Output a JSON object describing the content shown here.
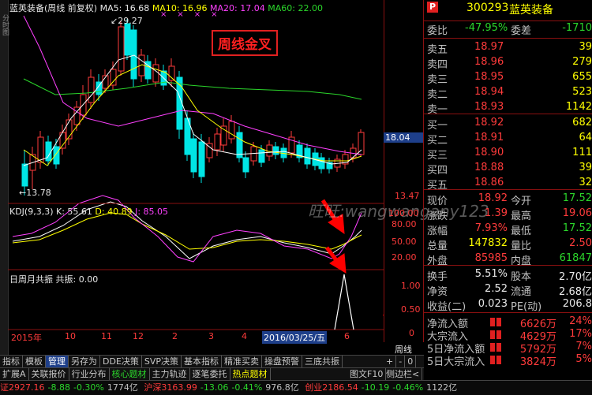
{
  "header": {
    "stock_name": "蓝英装备",
    "period": "周线 前复权",
    "ma5": "MA5: 16.68",
    "ma10": "MA10: 16.96",
    "ma20": "MA20: 17.04",
    "ma60": "MA60: 22.00"
  },
  "annotation": {
    "title": "周线金叉",
    "watermark": "旺旺:wangwangany123"
  },
  "price_axis": {
    "high_label": "29.27",
    "low_label": "13.78",
    "current": "18.04",
    "bottom": "13.47"
  },
  "kdj": {
    "title": "KDJ(9,3,3)",
    "k": "K: 55.61",
    "d": "D: 40.89",
    "j": "J: 85.05",
    "ticks": [
      "100.00",
      "80.00",
      "50.00",
      "20.00"
    ]
  },
  "resonance": {
    "title": "日周月共振",
    "value": "共振: 0.00",
    "ticks": [
      "1.00",
      "0.50",
      "0"
    ]
  },
  "timeline": {
    "labels": [
      "2015年",
      "10",
      "11",
      "12",
      "2",
      "3",
      "4",
      "5",
      "6"
    ],
    "highlight": "2016/03/25/五",
    "period_button": "周线"
  },
  "tabs": [
    "指标",
    "模板",
    "管理",
    "另存为",
    "DDE决策",
    "SVP决策",
    "基本指标",
    "精准买卖",
    "操盘预警",
    "三底共振"
  ],
  "tabs2": [
    "扩展A",
    "关联报价",
    "行业分布",
    "核心题材",
    "主力轨迹",
    "逐笔委托",
    "热点题材"
  ],
  "tabs2_right": [
    "图文F10",
    "侧边栏<"
  ],
  "controls": {
    "plus": "+",
    "minus": "-",
    "zero": "0",
    "pen": "笔"
  },
  "quote": {
    "code": "300293",
    "name": "蓝英装备",
    "wb_label": "委比",
    "wb_value": "-47.95%",
    "wc_label": "委差",
    "wc_value": "-1710",
    "asks": [
      {
        "label": "卖五",
        "price": "18.97",
        "vol": "39"
      },
      {
        "label": "卖四",
        "price": "18.96",
        "vol": "279"
      },
      {
        "label": "卖三",
        "price": "18.95",
        "vol": "655"
      },
      {
        "label": "卖二",
        "price": "18.94",
        "vol": "523"
      },
      {
        "label": "卖一",
        "price": "18.93",
        "vol": "1142"
      }
    ],
    "bids": [
      {
        "label": "买一",
        "price": "18.92",
        "vol": "682"
      },
      {
        "label": "买二",
        "price": "18.91",
        "vol": "64"
      },
      {
        "label": "买三",
        "price": "18.90",
        "vol": "111"
      },
      {
        "label": "买四",
        "price": "18.88",
        "vol": "39"
      },
      {
        "label": "买五",
        "price": "18.86",
        "vol": "32"
      }
    ],
    "stats": [
      {
        "l1": "现价",
        "v1": "18.92",
        "l2": "今开",
        "v2": "17.52",
        "c1": "red",
        "c2": "green"
      },
      {
        "l1": "涨跌",
        "v1": "1.39",
        "l2": "最高",
        "v2": "19.06",
        "c1": "red",
        "c2": "red"
      },
      {
        "l1": "涨幅",
        "v1": "7.93%",
        "l2": "最低",
        "v2": "17.52",
        "c1": "red",
        "c2": "green"
      },
      {
        "l1": "总量",
        "v1": "147832",
        "l2": "量比",
        "v2": "2.50",
        "c1": "yellow",
        "c2": "red"
      },
      {
        "l1": "外盘",
        "v1": "85985",
        "l2": "内盘",
        "v2": "61847",
        "c1": "red",
        "c2": "green"
      }
    ],
    "stats2": [
      {
        "l1": "换手",
        "v1": "5.51%",
        "l2": "股本",
        "v2": "2.70亿"
      },
      {
        "l1": "净资",
        "v1": "2.52",
        "l2": "流通",
        "v2": "2.68亿"
      },
      {
        "l1": "收益(二)",
        "v1": "0.023",
        "l2": "PE(动)",
        "v2": "206.8"
      }
    ],
    "flows": [
      {
        "label": "净流入额",
        "amount": "6626万",
        "pct": "24%"
      },
      {
        "label": "大宗流入",
        "amount": "4629万",
        "pct": "17%"
      },
      {
        "label": "5日净流入额",
        "amount": "5792万",
        "pct": "7%"
      },
      {
        "label": "5日大宗流入",
        "amount": "3824万",
        "pct": "5%"
      }
    ]
  },
  "status_bar": {
    "items": [
      "证2927.16",
      "-8.88",
      "-0.30%",
      "1774亿",
      "沪深3163.99",
      "-13.06",
      "-0.41%",
      "976.8亿",
      "创业2186.54",
      "-10.19",
      "-0.46%",
      "1122亿"
    ]
  },
  "colors": {
    "up": "#ff3b3b",
    "down": "#00e5e5",
    "ma5": "#ffffff",
    "ma10": "#ffff00",
    "ma20": "#ff40ff",
    "ma60": "#2bd62b",
    "k": "#ffffff",
    "d": "#ffff00",
    "j": "#ff40ff",
    "arrow": "#ff0000"
  }
}
